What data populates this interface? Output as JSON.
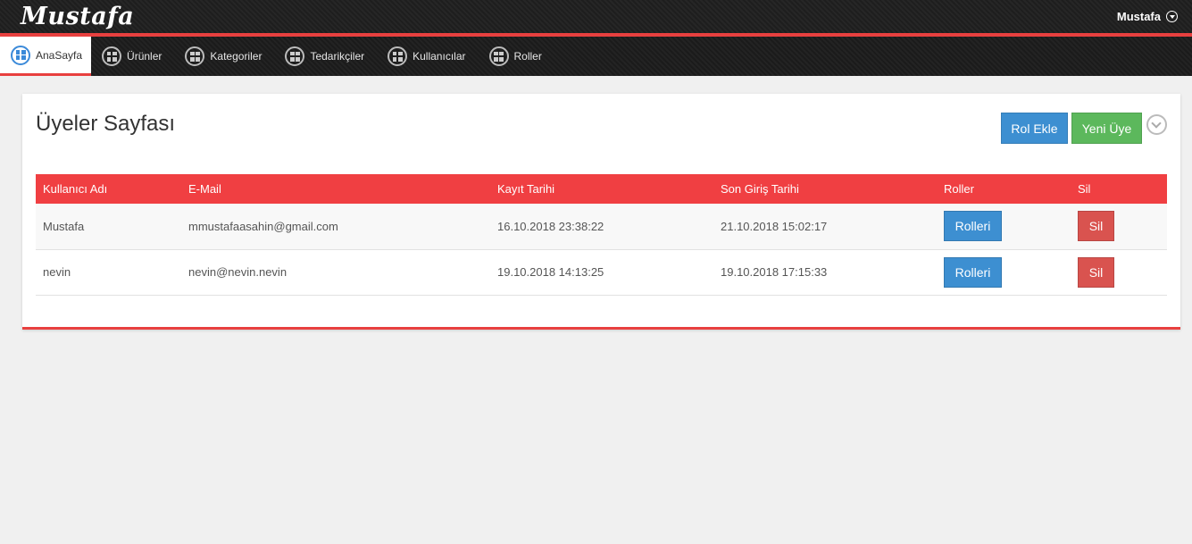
{
  "header": {
    "logo": "Mustafa",
    "user_name": "Mustafa"
  },
  "nav": {
    "items": [
      {
        "label": "AnaSayfa",
        "active": true
      },
      {
        "label": "Ürünler"
      },
      {
        "label": "Kategoriler"
      },
      {
        "label": "Tedarikçiler"
      },
      {
        "label": "Kullanıcılar"
      },
      {
        "label": "Roller"
      }
    ]
  },
  "page": {
    "title": "Üyeler Sayfası",
    "rol_ekle_label": "Rol Ekle",
    "yeni_uye_label": "Yeni Üye"
  },
  "table": {
    "columns": [
      "Kullanıcı Adı",
      "E-Mail",
      "Kayıt Tarihi",
      "Son Giriş Tarihi",
      "Roller",
      "Sil"
    ],
    "rows": [
      {
        "username": "Mustafa",
        "email": "mmustafaasahin@gmail.com",
        "registered": "16.10.2018 23:38:22",
        "last_login": "21.10.2018 15:02:17",
        "roles_label": "Rolleri",
        "delete_label": "Sil"
      },
      {
        "username": "nevin",
        "email": "nevin@nevin.nevin",
        "registered": "19.10.2018 14:13:25",
        "last_login": "19.10.2018 17:15:33",
        "roles_label": "Rolleri",
        "delete_label": "Sil"
      }
    ]
  },
  "colors": {
    "accent": "#e8403f",
    "primary": "#3d8fd1",
    "success": "#5cb85c",
    "danger": "#d9534f"
  }
}
